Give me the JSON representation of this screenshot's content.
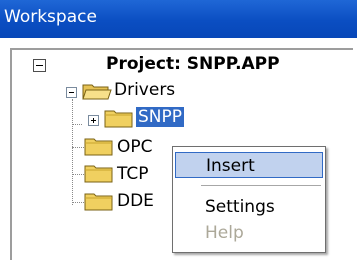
{
  "window": {
    "title": "Workspace"
  },
  "tree": {
    "project": "Project: SNPP.APP",
    "drivers": "Drivers",
    "snpp": "SNPP",
    "opc": "OPC",
    "tcp": "TCP",
    "dde": "DDE"
  },
  "context_menu": {
    "insert": "Insert",
    "settings": "Settings",
    "help": "Help"
  },
  "colors": {
    "titlebar": "#0b4ec2",
    "selection": "#316ac5",
    "menu_hover": "#c1d2ee",
    "folder": "#f0d060"
  }
}
